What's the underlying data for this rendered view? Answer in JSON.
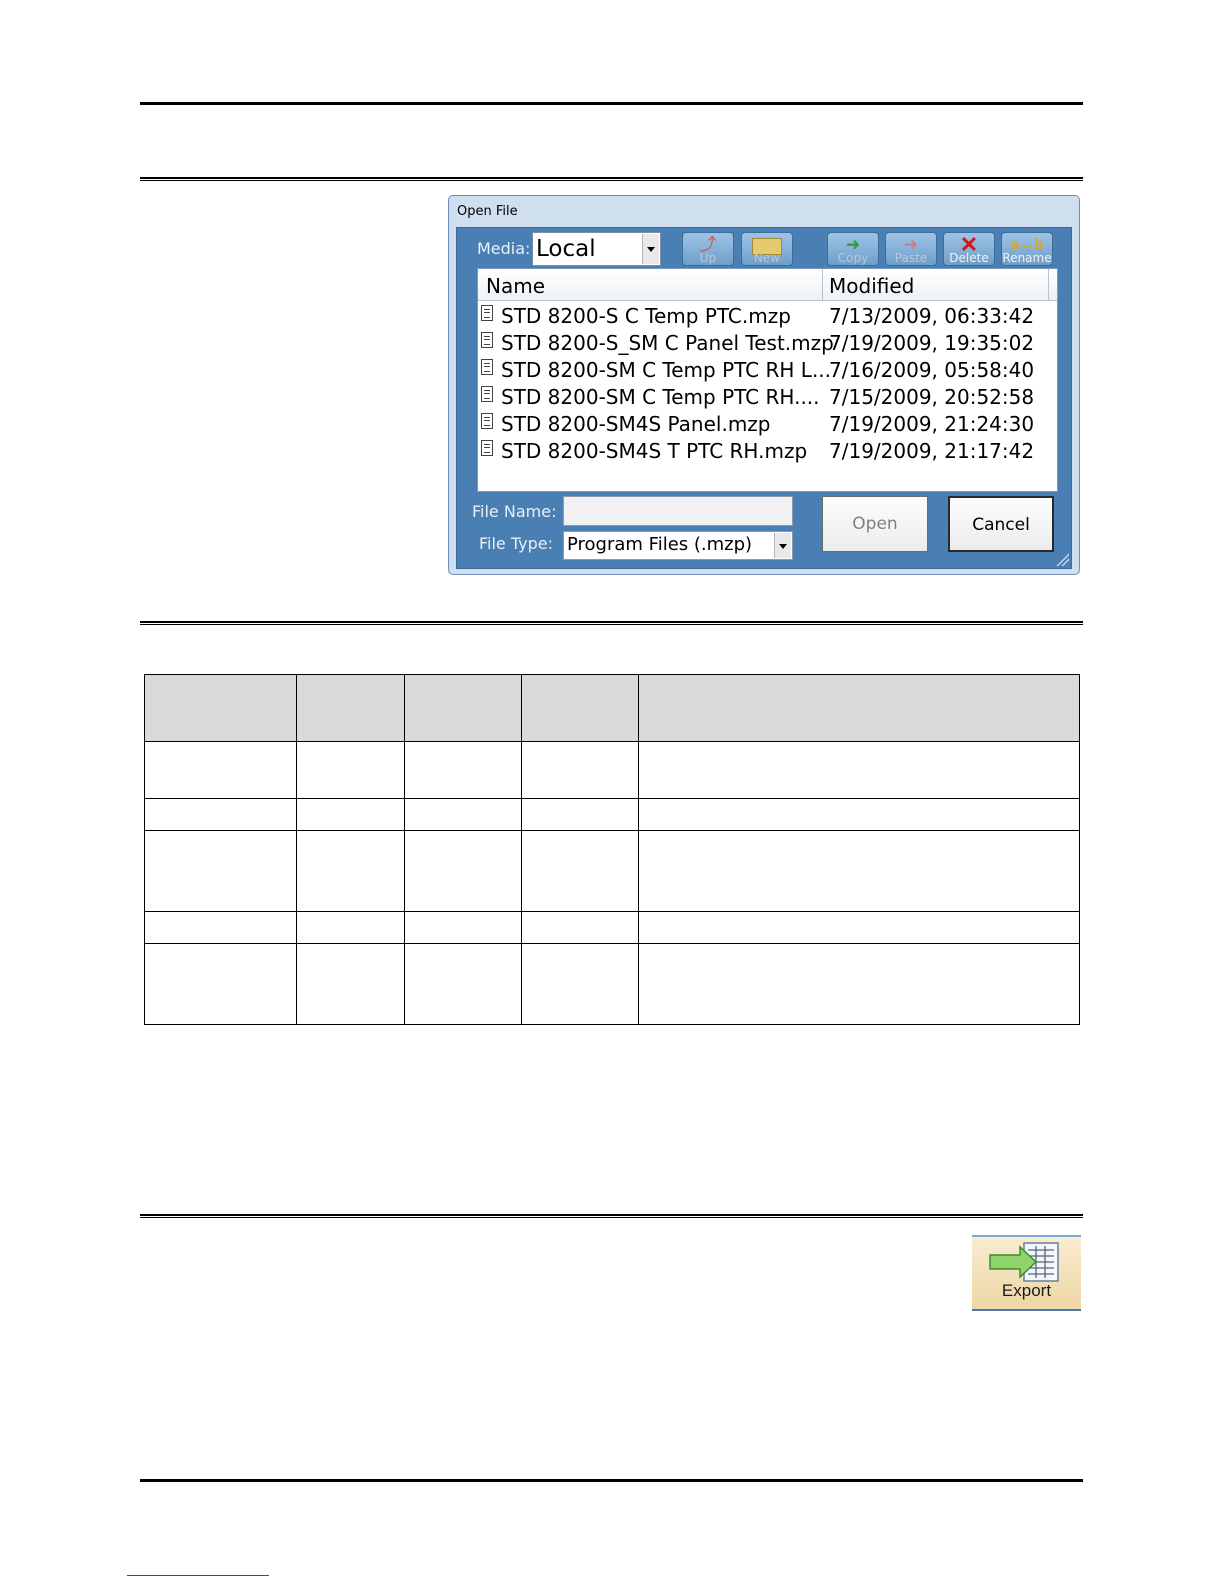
{
  "dialog": {
    "title": "Open File",
    "media_label": "Media:",
    "media_value": "Local",
    "toolbar": {
      "up": "Up",
      "new": "New",
      "copy": "Copy",
      "paste": "Paste",
      "delete": "Delete",
      "rename": "Rename",
      "rename_glyph": "a→b"
    },
    "columns": {
      "name": "Name",
      "modified": "Modified"
    },
    "files": [
      {
        "name": "STD 8200-S C Temp PTC.mzp",
        "modified": "7/13/2009, 06:33:42"
      },
      {
        "name": "STD 8200-S_SM C Panel Test.mzp",
        "modified": "7/19/2009, 19:35:02"
      },
      {
        "name": "STD 8200-SM C Temp PTC RH L...",
        "modified": "7/16/2009, 05:58:40"
      },
      {
        "name": "STD 8200-SM C Temp PTC RH....",
        "modified": "7/15/2009, 20:52:58"
      },
      {
        "name": "STD 8200-SM4S Panel.mzp",
        "modified": "7/19/2009, 21:24:30"
      },
      {
        "name": "STD 8200-SM4S T PTC RH.mzp",
        "modified": "7/19/2009, 21:17:42"
      }
    ],
    "file_name_label": "File Name:",
    "file_name_value": "",
    "file_type_label": "File Type:",
    "file_type_value": "Program Files (.mzp)",
    "open_label": "Open",
    "cancel_label": "Cancel"
  },
  "export_button": {
    "label": "Export",
    "icon": "export-arrow-icon"
  },
  "colors": {
    "dialog_body": "#4a7fb4",
    "table_header": "#d9d9d9"
  }
}
